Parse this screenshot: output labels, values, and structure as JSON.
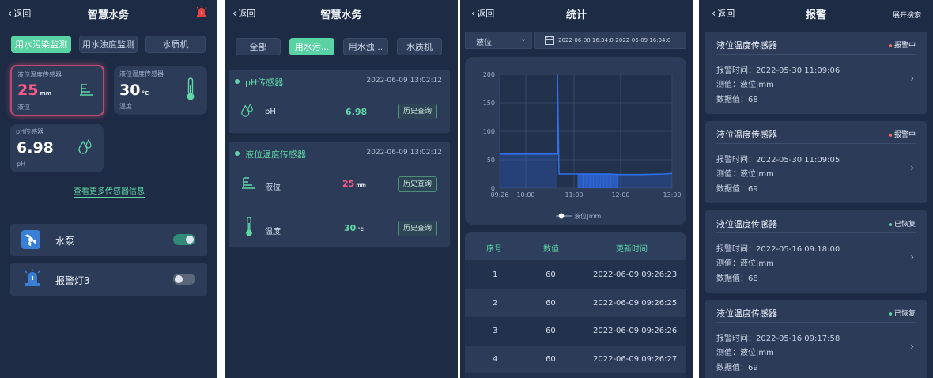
{
  "common": {
    "back_label": "返回"
  },
  "s1": {
    "title": "智慧水务",
    "tabs": [
      "用水污染监测",
      "用水浊度监测",
      "水质机"
    ],
    "cards": [
      {
        "name": "液位温度传感器",
        "value": "25",
        "unit": "mm",
        "label": "液位"
      },
      {
        "name": "液位温度传感器",
        "value": "30",
        "unit": "°C",
        "label": "温度"
      },
      {
        "name": "pH传感器",
        "value": "6.98",
        "unit": "",
        "label": "pH"
      }
    ],
    "more_link": "查看更多传感器信息",
    "devices": [
      {
        "name": "水泵",
        "on": true
      },
      {
        "name": "报警灯3",
        "on": false
      }
    ]
  },
  "s2": {
    "title": "智慧水务",
    "tabs": [
      "全部",
      "用水污...",
      "用水浊...",
      "水质机"
    ],
    "groups": [
      {
        "name": "pH传感器",
        "time": "2022-06-09 13:02:12",
        "items": [
          {
            "label": "pH",
            "value": "6.98",
            "unit": "",
            "btn": "历史查询"
          }
        ]
      },
      {
        "name": "液位温度传感器",
        "time": "2022-06-09 13:02:12",
        "items": [
          {
            "label": "液位",
            "value": "25",
            "unit": "mm",
            "btn": "历史查询"
          },
          {
            "label": "温度",
            "value": "30",
            "unit": "°C",
            "btn": "历史查询"
          }
        ]
      }
    ]
  },
  "s3": {
    "title": "统计",
    "select_value": "液位",
    "date_range": "2022-06-08 16:34:0-2022-06-09 16:34:0",
    "chart_data": {
      "type": "line",
      "x_ticks": [
        "09:26",
        "10:00",
        "11:00",
        "12:00",
        "13:00"
      ],
      "y_ticks": [
        0,
        50,
        100,
        150,
        200
      ],
      "ylim": [
        0,
        200
      ],
      "series": [
        {
          "name": "液位|mm"
        }
      ],
      "legend": "bottom-center",
      "grid": true,
      "color": "#2f6ff0"
    },
    "table": {
      "headers": [
        "序号",
        "数值",
        "更新时间"
      ],
      "rows": [
        [
          "1",
          "60",
          "2022-06-09 09:26:23"
        ],
        [
          "2",
          "60",
          "2022-06-09 09:26:25"
        ],
        [
          "3",
          "60",
          "2022-06-09 09:26:26"
        ],
        [
          "4",
          "60",
          "2022-06-09 09:26:27"
        ]
      ]
    }
  },
  "s4": {
    "title": "报警",
    "action": "展开搜索",
    "alarms": [
      {
        "name": "液位温度传感器",
        "status": "报警中",
        "status_color": "#ff6b6b",
        "time": "报警时间：2022-05-30 11:09:06",
        "measure": "测值：液位|mm",
        "data": "数据值：68"
      },
      {
        "name": "液位温度传感器",
        "status": "报警中",
        "status_color": "#ff6b6b",
        "time": "报警时间：2022-05-30 11:09:05",
        "measure": "测值：液位|mm",
        "data": "数据值：69"
      },
      {
        "name": "液位温度传感器",
        "status": "已恢复",
        "status_color": "#5fd8a6",
        "time": "报警时间：2022-05-16 09:18:00",
        "measure": "测值：液位|mm",
        "data": "数据值：68"
      },
      {
        "name": "液位温度传感器",
        "status": "已恢复",
        "status_color": "#5fd8a6",
        "time": "报警时间：2022-05-16 09:17:58",
        "measure": "测值：液位|mm",
        "data": "数据值：69"
      }
    ]
  }
}
